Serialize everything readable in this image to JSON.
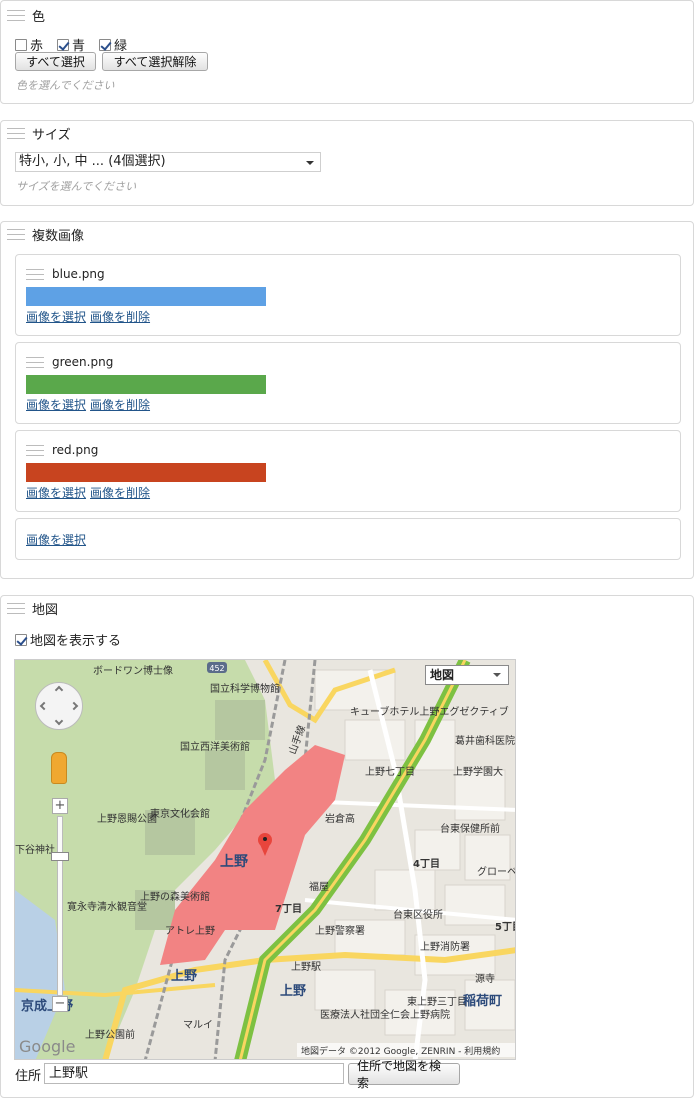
{
  "color_panel": {
    "title": "色",
    "options": [
      {
        "label": "赤",
        "checked": false
      },
      {
        "label": "青",
        "checked": true
      },
      {
        "label": "緑",
        "checked": true
      }
    ],
    "select_all_label": "すべて選択",
    "deselect_all_label": "すべて選択解除",
    "hint": "色を選んでください"
  },
  "size_panel": {
    "title": "サイズ",
    "selected_value": "特小, 小, 中 ... (4個選択)",
    "hint": "サイズを選んでください"
  },
  "images_panel": {
    "title": "複数画像",
    "items": [
      {
        "filename": "blue.png",
        "color": "#5ea1e5"
      },
      {
        "filename": "green.png",
        "color": "#5aa84b"
      },
      {
        "filename": "red.png",
        "color": "#c8441f"
      }
    ],
    "select_image_label": "画像を選択",
    "remove_image_label": "画像を削除",
    "add_select_label": "画像を選択"
  },
  "map_panel": {
    "title": "地図",
    "show_map_label": "地図を表示する",
    "show_map_checked": true,
    "map_type": "地図",
    "map_labels": [
      "ボードワン博士像",
      "国立科学博物館",
      "国立西洋美術館",
      "東京文化会館",
      "上野恩賜公園",
      "上野の森美術館",
      "寛永寺清水観音堂",
      "上野",
      "上野駅",
      "岩倉高",
      "福屋",
      "7丁目",
      "4丁目",
      "台東区役所",
      "上野警察署",
      "上野消防署",
      "上野学園大",
      "葛井歯科医院",
      "台東保健所前",
      "東上野三丁目",
      "稲荷町",
      "京成上野",
      "上野公園前",
      "医療法人社団全仁会上野病院",
      "マルイ",
      "アトレ上野",
      "キューブホテル上野エグゼクティブ",
      "上野七丁目",
      "グローベスイート",
      "5丁目",
      "源寺",
      "下谷神社"
    ],
    "attribution": "地図データ ©2012 Google, ZENRIN - 利用規約",
    "google_label": "Google",
    "road_badge": "452",
    "line_label": "山手線",
    "address_label": "住所",
    "address_value": "上野駅",
    "search_button_label": "住所で地図を検索"
  },
  "colors": {
    "park_green": "#c6dcab",
    "station_pink": "#f28383",
    "rail_green": "#7dc142",
    "road_yellow": "#f9d660",
    "link_blue": "#22558a"
  }
}
